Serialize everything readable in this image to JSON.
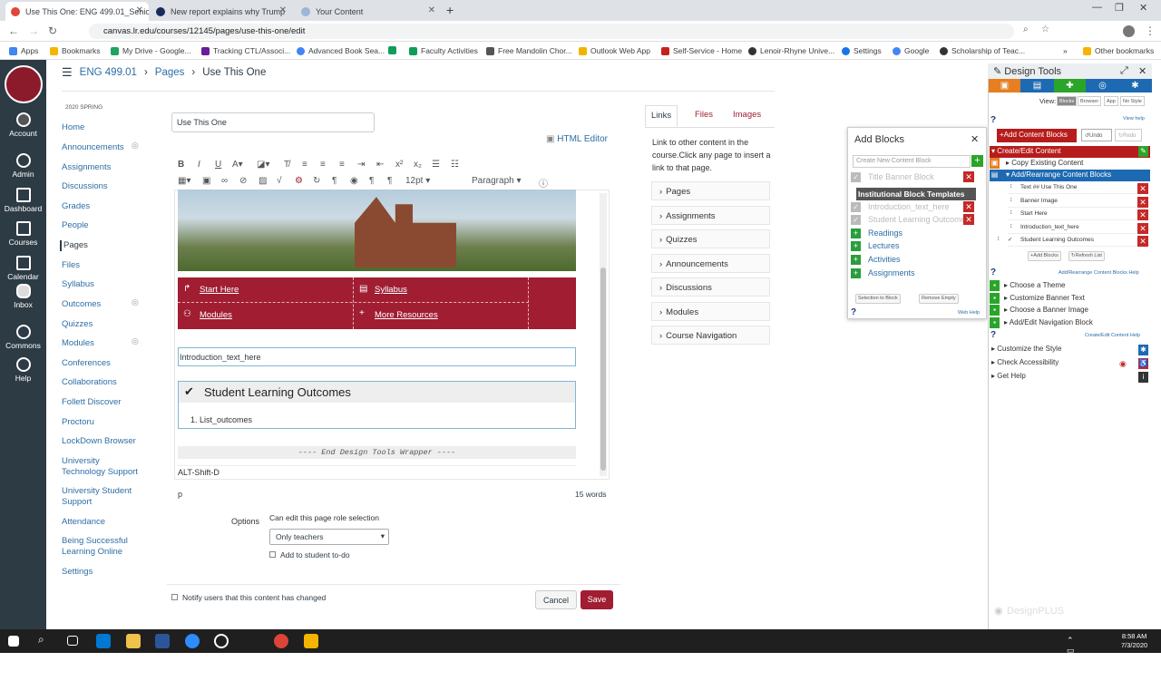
{
  "browser": {
    "tabs": [
      {
        "label": "Use This One: ENG 499.01_Senio"
      },
      {
        "label": "New report explains why Trump"
      },
      {
        "label": "Your Content"
      }
    ],
    "url": "canvas.lr.edu/courses/12145/pages/use-this-one/edit",
    "bookmarks": [
      "Apps",
      "Bookmarks",
      "My Drive - Google...",
      "Tracking CTL/Associ...",
      "Advanced Book Sea...",
      "Faculty Activities",
      "Free Mandolin Chor...",
      "Outlook Web App",
      "Self-Service - Home",
      "Lenoir-Rhyne Unive...",
      "Settings",
      "Google",
      "Scholarship of Teac..."
    ],
    "other_bookmarks": "Other bookmarks"
  },
  "global_nav": [
    {
      "label": "Account"
    },
    {
      "label": "Admin"
    },
    {
      "label": "Dashboard"
    },
    {
      "label": "Courses"
    },
    {
      "label": "Calendar"
    },
    {
      "label": "Inbox"
    },
    {
      "label": "Commons"
    },
    {
      "label": "Help"
    }
  ],
  "breadcrumb": {
    "course": "ENG 499.01",
    "section": "Pages",
    "page": "Use This One"
  },
  "term": "2020 SPRING",
  "course_nav": [
    "Home",
    "Announcements",
    "Assignments",
    "Discussions",
    "Grades",
    "People",
    "Pages",
    "Files",
    "Syllabus",
    "Outcomes",
    "Quizzes",
    "Modules",
    "Conferences",
    "Collaborations",
    "Follett Discover",
    "Proctoru",
    "LockDown Browser",
    "University Technology Support",
    "University Student Support",
    "Attendance",
    "Being Successful Learning Online",
    "Settings"
  ],
  "editor": {
    "title_value": "Use This One",
    "html_editor_label": "HTML Editor",
    "font_size": "12pt",
    "paragraph": "Paragraph",
    "nav_links": [
      "Start Here",
      "Syllabus",
      "Modules",
      "More Resources"
    ],
    "intro_text": "Introduction_text_here",
    "slo_heading": "Student Learning Outcomes",
    "slo_item": "1. List_outcomes",
    "end_wrapper": "---- End Design Tools Wrapper ----",
    "alt_shift": "ALT-Shift-D",
    "status_path": "p",
    "word_count": "15 words"
  },
  "options": {
    "label": "Options",
    "edit_label": "Can edit this page role selection",
    "role_value": "Only teachers",
    "todo_label": "Add to student to-do",
    "notify_label": "Notify users that this content has changed",
    "cancel": "Cancel",
    "save": "Save"
  },
  "content_panel": {
    "tabs": [
      "Links",
      "Files",
      "Images"
    ],
    "hint": "Link to other content in the course.Click any page to insert a link to that page.",
    "sections": [
      "Pages",
      "Assignments",
      "Quizzes",
      "Announcements",
      "Discussions",
      "Modules",
      "Course Navigation"
    ]
  },
  "add_blocks": {
    "title": "Add Blocks",
    "input_placeholder": "Create New Content Block",
    "title_banner": "Title Banner Block",
    "templates_label": "Institutional Block Templates",
    "disabled_items": [
      "Introduction_text_here",
      "Student Learning Outcomes"
    ],
    "items": [
      "Readings",
      "Lectures",
      "Activities",
      "Assignments"
    ],
    "selection_to_block": "Selection to Block",
    "remove_empty": "Remove Empty",
    "help": "Web Help"
  },
  "design_tools": {
    "title": "Design Tools",
    "view_label": "View:",
    "view_options": [
      "Blocks",
      "Browser",
      "App",
      "No Style"
    ],
    "view_help": "View help",
    "add_content_blocks": "Add Content Blocks",
    "undo": "Undo",
    "redo": "Redo",
    "create_edit": "Create/Edit Content",
    "copy_existing": "Copy Existing Content",
    "add_rearrange": "Add/Rearrange Content Blocks",
    "blocks": [
      "Text ## Use This One",
      "Banner Image",
      "Start Here",
      "Introduction_text_here",
      "Student Learning Outcomes"
    ],
    "add_blocks_btn": "Add Blocks",
    "refresh_list": "Refresh List",
    "rearrange_help": "Add/Rearrange Content Blocks Help",
    "menu": [
      "Choose a Theme",
      "Customize Banner Text",
      "Choose a Banner Image",
      "Add/Edit Navigation Block"
    ],
    "create_help": "Create/Edit Content Help",
    "customize_style": "Customize the Style",
    "check_accessibility": "Check Accessibility",
    "get_help": "Get Help",
    "watermark": "DesignPLUS"
  },
  "taskbar": {
    "time": "8:58 AM",
    "date": "7/3/2020"
  }
}
